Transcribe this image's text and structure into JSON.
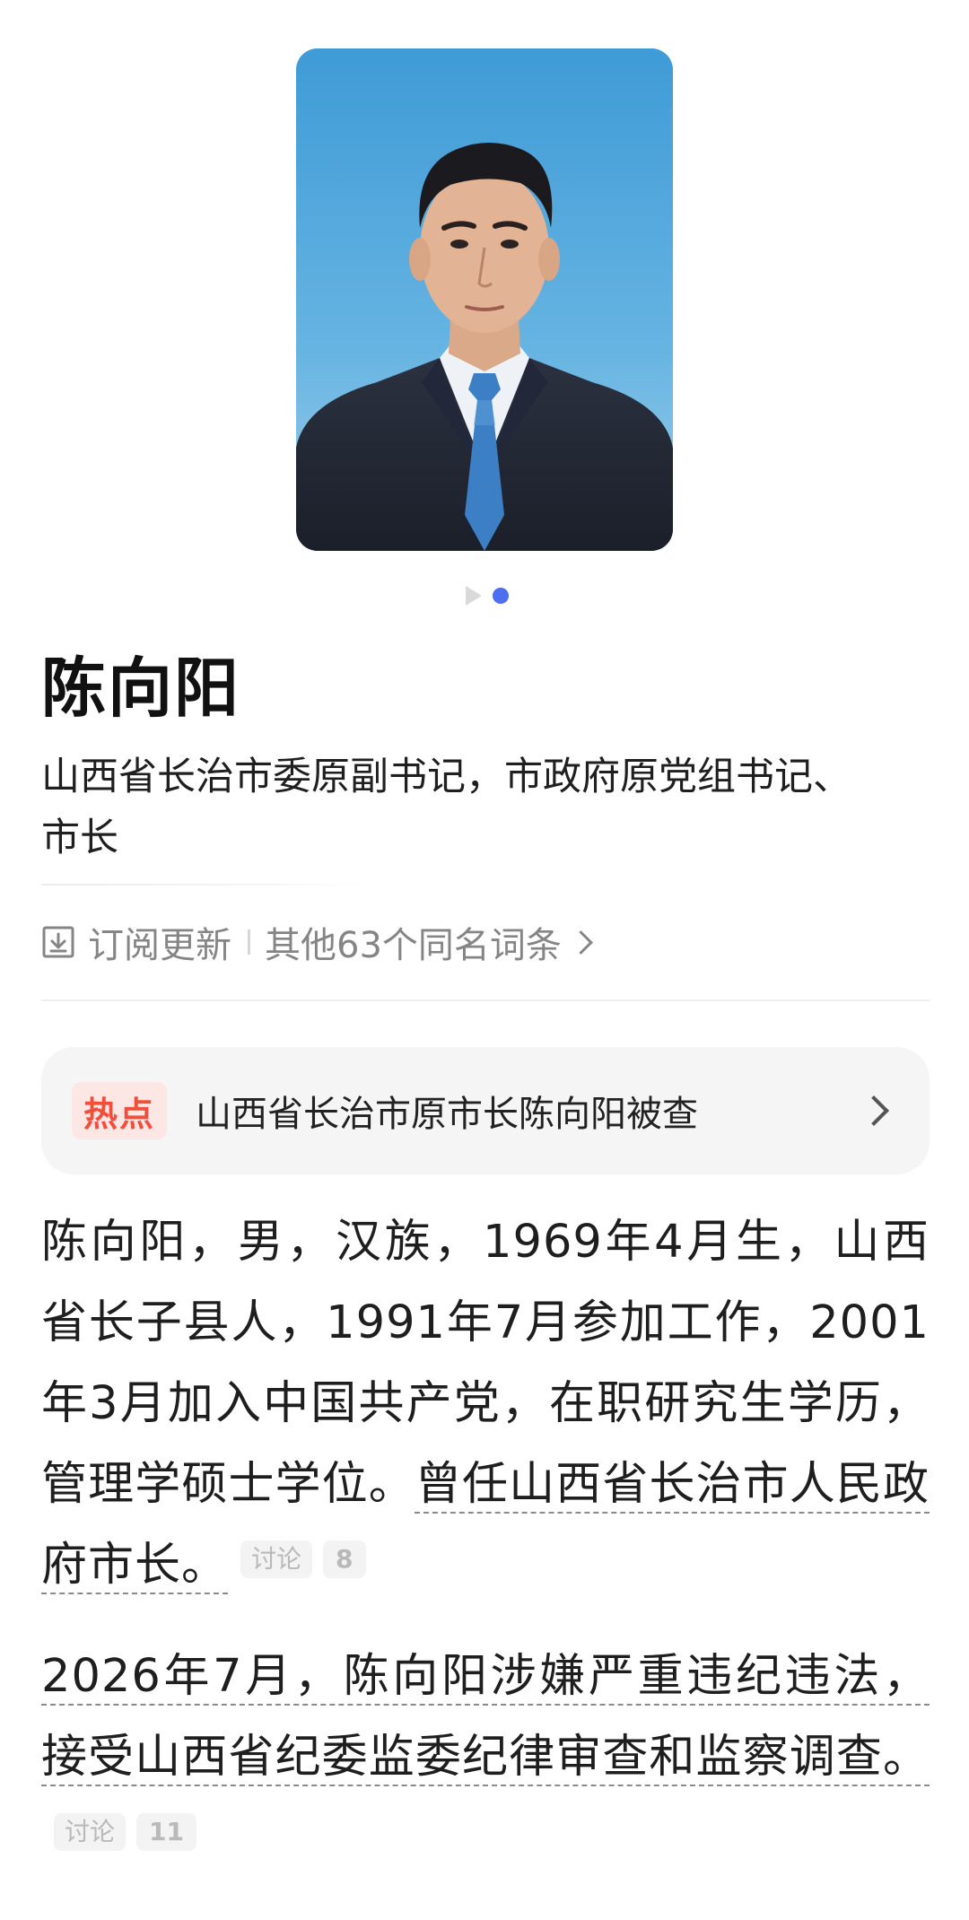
{
  "person": {
    "name": "陈向阳",
    "subtitle": "山西省长治市委原副书记，市政府原党组书记、市长"
  },
  "meta": {
    "subscribe_label": "订阅更新",
    "other_entries_label": "其他63个同名词条"
  },
  "hot": {
    "badge": "热点",
    "headline": "山西省长治市原市长陈向阳被查"
  },
  "body": {
    "para1_plain": "陈向阳，男，汉族，1969年4月生，山西省长子县人，1991年7月参加工作，2001年3月加入中国共产党，在职研究生学历，管理学硕士学位。",
    "para1_linked": "曾任山西省长治市人民政府市长。",
    "para1_tag": "讨论",
    "para1_count": "8",
    "para2_linked": "2026年7月，陈向阳涉嫌严重违纪违法，接受山西省纪委监委纪律审查和监察调查。",
    "para2_tag": "讨论",
    "para2_count": "11"
  },
  "colors": {
    "accent": "#4e6ef2",
    "hot_red": "#f24e3c",
    "hot_bg": "#fde7e4",
    "card_bg": "#f5f5f6",
    "photo_bg": "#4aa3d9"
  },
  "icons": {
    "subscribe": "bookmark-download-icon",
    "carousel_video": "play-icon",
    "arrow": "chevron-right-icon"
  }
}
